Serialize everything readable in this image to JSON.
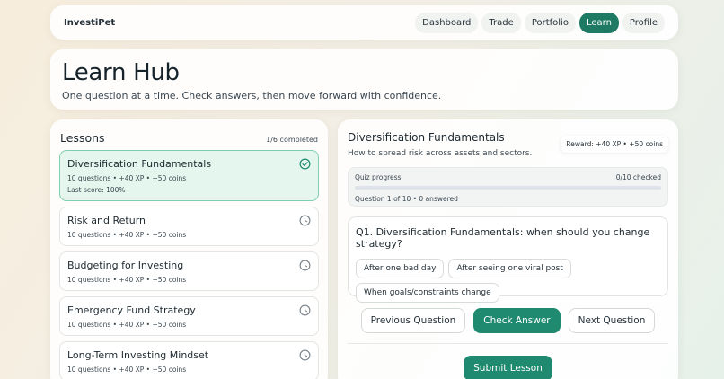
{
  "nav": {
    "brand": "InvestiPet",
    "items": [
      {
        "label": "Dashboard",
        "active": false
      },
      {
        "label": "Trade",
        "active": false
      },
      {
        "label": "Portfolio",
        "active": false
      },
      {
        "label": "Learn",
        "active": true
      },
      {
        "label": "Profile",
        "active": false
      }
    ]
  },
  "hero": {
    "title": "Learn Hub",
    "subtitle": "One question at a time. Check answers, then move forward with confidence."
  },
  "lessons": {
    "heading": "Lessons",
    "completed": "1/6 completed",
    "items": [
      {
        "title": "Diversification Fundamentals",
        "meta": "10 questions • +40 XP • +50 coins",
        "score": "Last score: 100%",
        "status_icon": "check-circle-icon"
      },
      {
        "title": "Risk and Return",
        "meta": "10 questions • +40 XP • +50 coins",
        "status_icon": "clock-icon"
      },
      {
        "title": "Budgeting for Investing",
        "meta": "10 questions • +40 XP • +50 coins",
        "status_icon": "clock-icon"
      },
      {
        "title": "Emergency Fund Strategy",
        "meta": "10 questions • +40 XP • +50 coins",
        "status_icon": "clock-icon"
      },
      {
        "title": "Long-Term Investing Mindset",
        "meta": "10 questions • +40 XP • +50 coins",
        "status_icon": "clock-icon"
      }
    ]
  },
  "quiz": {
    "title": "Diversification Fundamentals",
    "subtitle": "How to spread risk across assets and sectors.",
    "reward": "Reward: +40 XP • +50 coins",
    "progress_label": "Quiz progress",
    "progress_count": "0/10 checked",
    "progress_fraction": 0,
    "progress_status": "Question 1 of 10 • 0 answered",
    "question": "Q1. Diversification Fundamentals: when should you change strategy?",
    "options": [
      "After one bad day",
      "After seeing one viral post",
      "When goals/constraints change"
    ],
    "prev_label": "Previous Question",
    "check_label": "Check Answer",
    "next_label": "Next Question",
    "submit_label": "Submit Lesson"
  },
  "colors": {
    "accent": "#1f7a63",
    "active_lesson_bg": "#e4f6ed"
  }
}
